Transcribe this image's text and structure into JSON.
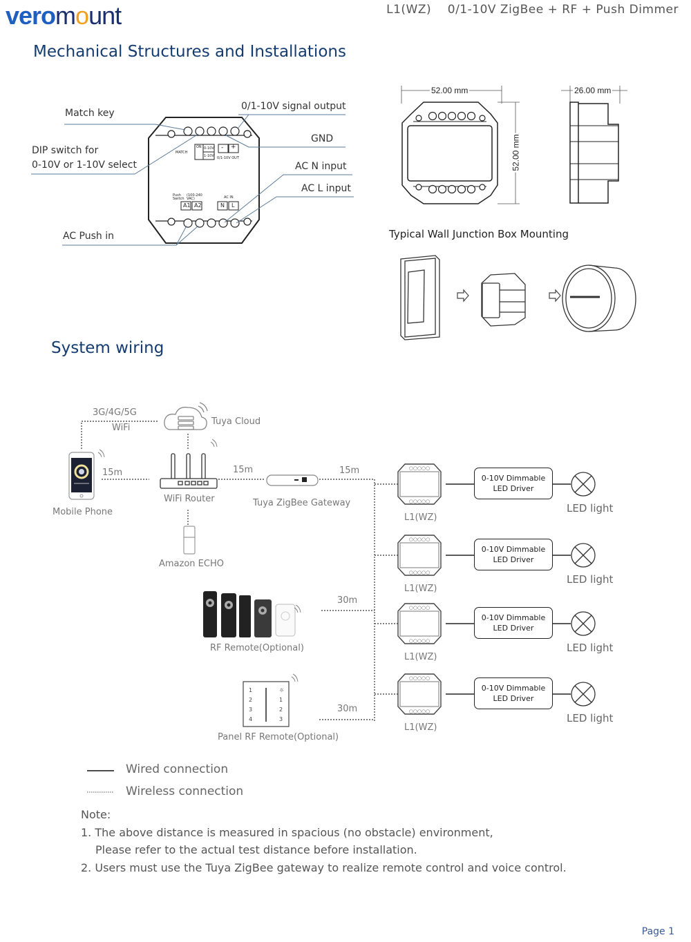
{
  "header": {
    "brand": {
      "part1": "vero",
      "part2": "m",
      "part3": "o",
      "part4": "unt"
    },
    "doc_title": "L1(WZ)    0/1-10V ZigBee + RF + Push Dimmer"
  },
  "mechanical": {
    "title": "Mechanical Structures and Installations",
    "callouts": {
      "match_key": "Match key",
      "dip_line1": "DIP switch for",
      "dip_line2": "0-10V or 1-10V select",
      "signal_output": "0/1-10V signal output",
      "gnd": "GND",
      "ac_n": "AC N input",
      "ac_l": "AC L input",
      "ac_push": "AC Push in"
    },
    "device_labels": {
      "match": "MATCH",
      "on": "ON",
      "v010": "0-10V",
      "v110": "1-10V",
      "minus": "-",
      "plus": "+",
      "out": "0/1-10V OUT",
      "push_switch": "Push Switch",
      "vac": "(100-240 VAC)",
      "a1": "A1",
      "a2": "A2",
      "ac_in": "AC IN",
      "n": "N",
      "l": "L"
    },
    "dimensions": {
      "width": "52.00 mm",
      "height": "52.00 mm",
      "depth": "26.00 mm"
    },
    "mounting_title": "Typical Wall Junction Box Mounting"
  },
  "wiring": {
    "title": "System wiring",
    "nodes": {
      "network": "3G/4G/5G",
      "wifi": "WiFi",
      "cloud": "Tuya Cloud",
      "phone": "Mobile Phone",
      "router": "WiFi Router",
      "gateway": "Tuya ZigBee Gateway",
      "echo": "Amazon ECHO",
      "rf_remote": "RF Remote(Optional)",
      "panel_remote": "Panel RF Remote(Optional)"
    },
    "distances": {
      "phone_router": "15m",
      "router_gateway": "15m",
      "gateway_dimmer": "15m",
      "rf_remote": "30m",
      "panel_remote": "30m"
    },
    "panel_keys": {
      "left": [
        "1",
        "2",
        "3",
        "4"
      ],
      "right": [
        "☼",
        "1",
        "2",
        "3"
      ]
    },
    "branches": [
      {
        "dimmer": "L1(WZ)",
        "driver_line1": "0-10V Dimmable",
        "driver_line2": "LED Driver",
        "light": "LED light"
      },
      {
        "dimmer": "L1(WZ)",
        "driver_line1": "0-10V Dimmable",
        "driver_line2": "LED Driver",
        "light": "LED light"
      },
      {
        "dimmer": "L1(WZ)",
        "driver_line1": "0-10V Dimmable",
        "driver_line2": "LED Driver",
        "light": "LED light"
      },
      {
        "dimmer": "L1(WZ)",
        "driver_line1": "0-10V Dimmable",
        "driver_line2": "LED Driver",
        "light": "LED light"
      }
    ],
    "legend": {
      "wired": "Wired connection",
      "wireless": "Wireless connection"
    }
  },
  "notes": {
    "heading": "Note:",
    "item1_line1": "1. The above distance is measured in spacious (no obstacle) environment,",
    "item1_line2": "Please refer to the actual test distance before installation.",
    "item2": "2. Users must use the Tuya ZigBee gateway to realize remote control and voice control."
  },
  "footer": {
    "page": "Page 1"
  },
  "colors": {
    "title_blue": "#143c70",
    "brand_blue": "#1f5fc0",
    "brand_orange": "#f0a020",
    "page_blue": "#3a5a9a"
  }
}
